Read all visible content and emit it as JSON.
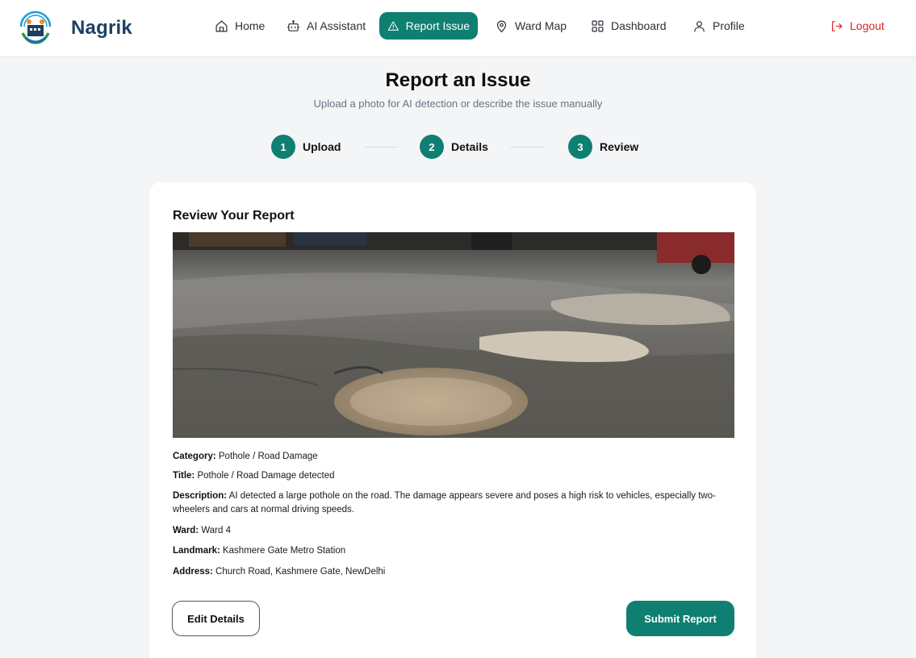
{
  "brand": {
    "name": "Nagrik",
    "logo_icon": "logo-icon"
  },
  "nav": {
    "items": [
      {
        "label": "Home",
        "icon": "home-icon"
      },
      {
        "label": "AI Assistant",
        "icon": "bot-icon"
      },
      {
        "label": "Report Issue",
        "icon": "warning-triangle-icon",
        "active": true
      },
      {
        "label": "Ward Map",
        "icon": "map-pin-icon"
      },
      {
        "label": "Dashboard",
        "icon": "dashboard-grid-icon"
      },
      {
        "label": "Profile",
        "icon": "user-icon"
      }
    ],
    "logout": {
      "label": "Logout",
      "icon": "logout-icon"
    }
  },
  "header": {
    "title": "Report an Issue",
    "subtitle": "Upload a photo for AI detection or describe the issue manually"
  },
  "stepper": {
    "steps": [
      {
        "number": "1",
        "label": "Upload"
      },
      {
        "number": "2",
        "label": "Details"
      },
      {
        "number": "3",
        "label": "Review"
      }
    ]
  },
  "review": {
    "title": "Review Your Report",
    "photo": "pothole-road-photo",
    "fields": {
      "category": {
        "label": "Category:",
        "value": " Pothole / Road Damage"
      },
      "title": {
        "label": "Title:",
        "value": " Pothole / Road Damage detected"
      },
      "description": {
        "label": "Description:",
        "value": " AI detected a large pothole on the road. The damage appears severe and poses a high risk to vehicles, especially two-wheelers and cars at normal driving speeds."
      },
      "ward": {
        "label": "Ward:",
        "value": " Ward 4"
      },
      "landmark": {
        "label": "Landmark:",
        "value": " Kashmere Gate Metro Station"
      },
      "address": {
        "label": "Address:",
        "value": " Church Road, Kashmere Gate, NewDelhi"
      }
    },
    "edit_label": "Edit Details",
    "submit_label": "Submit Report"
  },
  "colors": {
    "accent": "#0f7f72",
    "brand_text": "#1e3f63",
    "logout": "#e02424",
    "background": "#f3f5f7"
  }
}
